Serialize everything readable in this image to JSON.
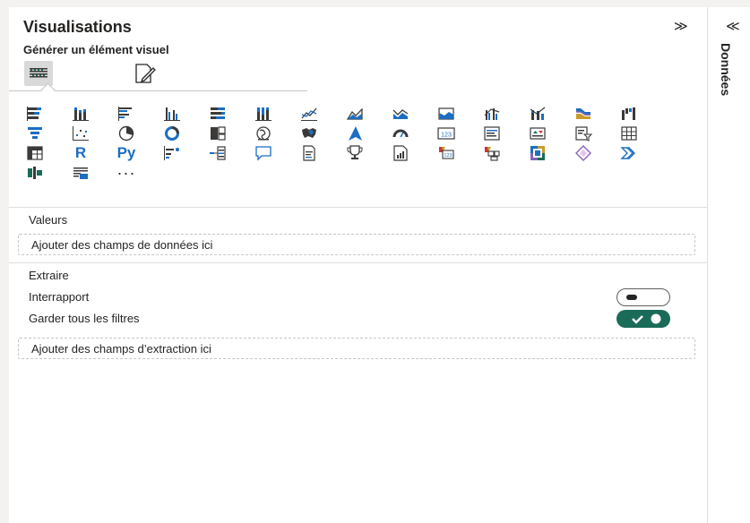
{
  "panel": {
    "title": "Visualisations",
    "collapse_glyph": "≫",
    "subtitle": "Générer un élément visuel",
    "modes": [
      {
        "icon": "build-visual-icon",
        "active": true
      },
      {
        "icon": "format-visual-icon",
        "active": false
      }
    ]
  },
  "visual_icons": [
    [
      "stacked-bar-chart-icon",
      "stacked-column-chart-icon",
      "clustered-bar-chart-icon",
      "clustered-column-chart-icon",
      "100-stacked-bar-chart-icon",
      "100-stacked-column-chart-icon",
      "line-chart-icon",
      "area-chart-icon",
      "stacked-area-chart-icon",
      "100-stacked-area-chart-icon",
      "line-clustered-column-chart-icon",
      "line-stacked-column-chart-icon",
      "ribbon-chart-icon",
      "waterfall-chart-icon"
    ],
    [
      "funnel-chart-icon",
      "scatter-chart-icon",
      "pie-chart-icon",
      "donut-chart-icon",
      "treemap-icon",
      "map-icon",
      "filled-map-icon",
      "azure-map-icon",
      "gauge-icon",
      "card-icon",
      "multi-row-card-icon",
      "kpi-icon",
      "slicer-icon",
      "table-icon"
    ],
    [
      "matrix-icon",
      "r-visual-icon",
      "python-visual-icon",
      "key-influencers-icon",
      "decomposition-tree-icon",
      "qa-icon",
      "smart-narrative-icon",
      "goals-icon",
      "paginated-report-icon",
      "power-apps-icon",
      "power-automate-icon",
      "metrics-icon",
      "new-card-icon",
      "chevron-visual-icon"
    ],
    [
      "azure-maps-custom-icon",
      "filter-chart-icon",
      "more-visuals-icon"
    ]
  ],
  "visual_text": {
    "r": "R",
    "py": "Py",
    "more": "···"
  },
  "values_section": {
    "label": "Valeurs",
    "well_placeholder": "Ajouter des champs de données ici"
  },
  "drillthrough": {
    "label": "Extraire",
    "cross_report_label": "Interrapport",
    "cross_report_on": false,
    "keep_filters_label": "Garder tous les filtres",
    "keep_filters_on": true,
    "well_placeholder": "Ajouter des champs d’extraction ici"
  },
  "right_rail": {
    "chevron_glyph": "≪",
    "label": "Données"
  },
  "colors": {
    "accent_teal": "#1a6b58",
    "icon_blue": "#1b6ec2",
    "icon_dark": "#3b3a39"
  }
}
